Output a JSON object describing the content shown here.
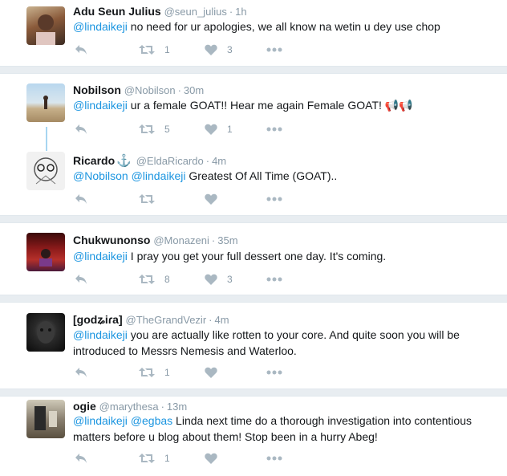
{
  "tweets": [
    {
      "name": "Adu Seun Julius",
      "handle": "@seun_julius",
      "time": "1h",
      "mention1": "@lindaikeji",
      "text": " no need for ur apologies, we all know na wetin u dey use chop",
      "retweets": "1",
      "likes": "3"
    },
    {
      "name": "Nobilson",
      "handle": "@Nobilson",
      "time": "30m",
      "mention1": "@lindaikeji",
      "text": " ur a female GOAT!! Hear me again Female GOAT! ",
      "emoji": "📢📢",
      "retweets": "5",
      "likes": "1"
    },
    {
      "name": "Ricardo",
      "name_suffix": "⚓",
      "handle": "@EldaRicardo",
      "time": "4m",
      "mention1": "@Nobilson",
      "mention2": "@lindaikeji",
      "text": " Greatest Of All Time (GOAT)..",
      "retweets": "",
      "likes": ""
    },
    {
      "name": "Chukwunonso",
      "handle": "@Monazeni",
      "time": "35m",
      "mention1": "@lindaikeji",
      "text": " I pray you get your full dessert one day. It's coming.",
      "retweets": "8",
      "likes": "3"
    },
    {
      "name": "[godʑiɾa]",
      "handle": "@TheGrandVezir",
      "time": "4m",
      "mention1": "@lindaikeji",
      "text": " you are actually like rotten to your core. And quite soon you will be introduced to Messrs Nemesis and Waterloo.",
      "retweets": "1",
      "likes": ""
    },
    {
      "name": "ogie",
      "handle": "@marythesa",
      "time": "13m",
      "mention1": "@lindaikeji",
      "mention2": "@egbas",
      "text": " Linda next time do a thorough investigation into contentious matters before u blog about them! Stop been in a hurry Abeg!",
      "retweets": "1",
      "likes": ""
    }
  ],
  "separator_dot": "·",
  "colors": {
    "link": "#1b95e0",
    "muted": "#8899a6",
    "separator": "#e8edf1",
    "thread_line": "#a7d5f1"
  },
  "icons": [
    "reply-icon",
    "retweet-icon",
    "like-icon",
    "more-icon",
    "anchor-icon",
    "megaphone-icon"
  ]
}
